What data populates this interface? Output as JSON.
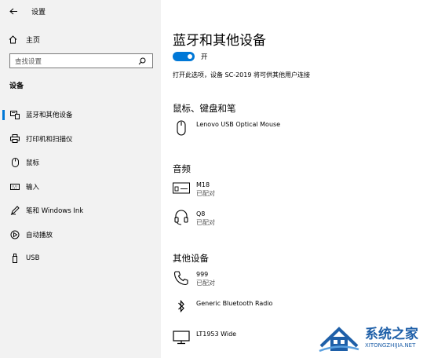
{
  "window": {
    "title": "设置"
  },
  "sidebar": {
    "home_label": "主页",
    "search_placeholder": "查找设置",
    "section_label": "设备",
    "items": [
      {
        "label": "蓝牙和其他设备",
        "icon": "bluetooth-devices-icon",
        "selected": true
      },
      {
        "label": "打印机和扫描仪",
        "icon": "printer-icon",
        "selected": false
      },
      {
        "label": "鼠标",
        "icon": "mouse-icon",
        "selected": false
      },
      {
        "label": "输入",
        "icon": "keyboard-icon",
        "selected": false
      },
      {
        "label": "笔和 Windows Ink",
        "icon": "pen-icon",
        "selected": false
      },
      {
        "label": "自动播放",
        "icon": "autoplay-icon",
        "selected": false
      },
      {
        "label": "USB",
        "icon": "usb-icon",
        "selected": false
      }
    ]
  },
  "main": {
    "title": "蓝牙和其他设备",
    "bluetooth_toggle": {
      "state_label": "开",
      "on": true
    },
    "description": "打开此选项，设备 SC-2019 将可供其他用户连接",
    "groups": {
      "mouse": {
        "title": "鼠标、键盘和笔",
        "devices": [
          {
            "name": "Lenovo USB Optical Mouse",
            "icon": "mouse-icon"
          }
        ]
      },
      "audio": {
        "title": "音频",
        "devices": [
          {
            "name": "M18",
            "status": "已配对",
            "icon": "display-audio-icon"
          },
          {
            "name": "Q8",
            "status": "已配对",
            "icon": "headset-icon"
          }
        ]
      },
      "other": {
        "title": "其他设备",
        "devices": [
          {
            "name": "999",
            "status": "已配对",
            "icon": "phone-icon"
          },
          {
            "name": "Generic Bluetooth Radio",
            "icon": "bluetooth-icon"
          },
          {
            "name": "LT1953 Wide",
            "icon": "monitor-icon"
          }
        ]
      }
    }
  },
  "watermark": {
    "main": "系统之家",
    "sub": "XITONGZHIJIA.NET"
  },
  "colors": {
    "accent": "#0078d7",
    "sidebar_bg": "#f2f2f2",
    "watermark": "#1e5fa8"
  }
}
